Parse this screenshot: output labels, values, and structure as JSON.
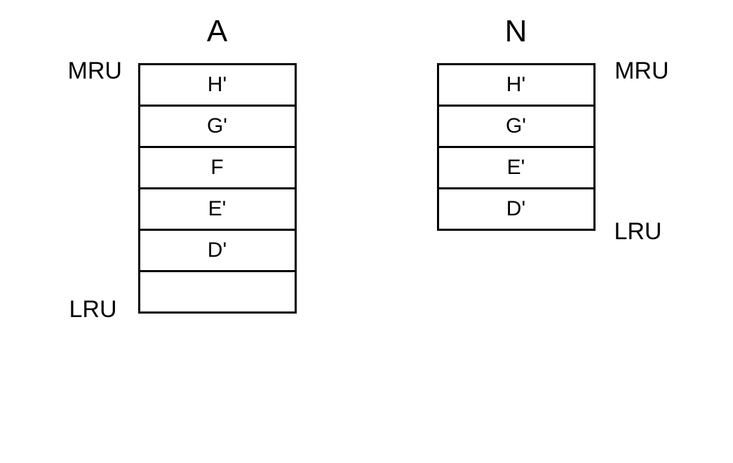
{
  "columns": [
    {
      "header": "A",
      "mruLabel": "MRU",
      "lruLabel": "LRU",
      "labelSide": "left",
      "cells": [
        "H'",
        "G'",
        "F",
        "E'",
        "D'",
        ""
      ]
    },
    {
      "header": "N",
      "mruLabel": "MRU",
      "lruLabel": "LRU",
      "labelSide": "right",
      "cells": [
        "H'",
        "G'",
        "E'",
        "D'"
      ]
    }
  ]
}
